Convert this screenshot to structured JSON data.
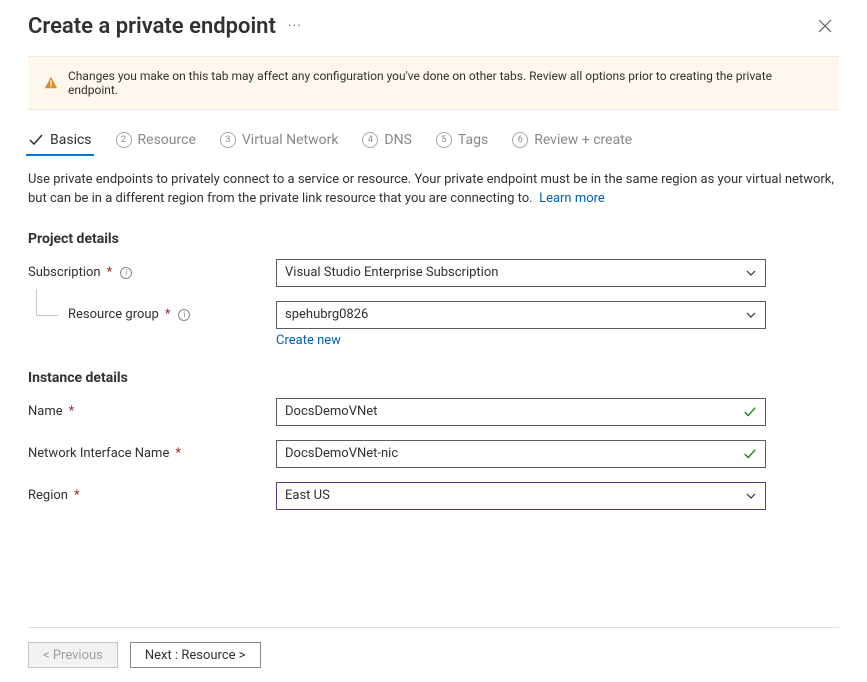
{
  "header": {
    "title": "Create a private endpoint"
  },
  "banner": {
    "text": "Changes you make on this tab may affect any configuration you've done on other tabs. Review all options prior to creating the private endpoint."
  },
  "tabs": [
    {
      "label": "Basics",
      "num": "",
      "active": true
    },
    {
      "label": "Resource",
      "num": "2",
      "active": false
    },
    {
      "label": "Virtual Network",
      "num": "3",
      "active": false
    },
    {
      "label": "DNS",
      "num": "4",
      "active": false
    },
    {
      "label": "Tags",
      "num": "5",
      "active": false
    },
    {
      "label": "Review + create",
      "num": "6",
      "active": false
    }
  ],
  "description": {
    "text": "Use private endpoints to privately connect to a service or resource. Your private endpoint must be in the same region as your virtual network, but can be in a different region from the private link resource that you are connecting to.",
    "learn_more": "Learn more"
  },
  "sections": {
    "project": {
      "title": "Project details",
      "subscription": {
        "label": "Subscription",
        "value": "Visual Studio Enterprise Subscription"
      },
      "resource_group": {
        "label": "Resource group",
        "value": "spehubrg0826",
        "create_new": "Create new"
      }
    },
    "instance": {
      "title": "Instance details",
      "name": {
        "label": "Name",
        "value": "DocsDemoVNet"
      },
      "nic": {
        "label": "Network Interface Name",
        "value": "DocsDemoVNet-nic"
      },
      "region": {
        "label": "Region",
        "value": "East US"
      }
    }
  },
  "footer": {
    "prev": "< Previous",
    "next": "Next : Resource >"
  }
}
